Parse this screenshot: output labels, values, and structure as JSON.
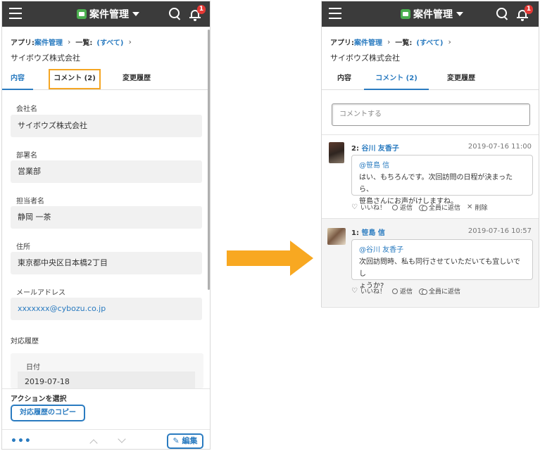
{
  "colors": {
    "accent": "#2a7bc0",
    "highlight": "#f5a623",
    "arrow": "#f8a821",
    "topbar": "#3b3b3b",
    "badge": "#e53935"
  },
  "left": {
    "app_title": "案件管理",
    "notification_count": "1",
    "breadcrumb": {
      "app_label": "アプリ:",
      "app_name": "案件管理",
      "list_label": "一覧:",
      "list_name": "(すべて)"
    },
    "record_title": "サイボウズ株式会社",
    "tabs": [
      "内容",
      "コメント (2)",
      "変更履歴"
    ],
    "fields": [
      {
        "label": "会社名",
        "value": "サイボウズ株式会社"
      },
      {
        "label": "部署名",
        "value": "営業部"
      },
      {
        "label": "担当者名",
        "value": "静岡 一茶"
      },
      {
        "label": "住所",
        "value": "東京都中央区日本橋2丁目"
      },
      {
        "label": "メールアドレス",
        "value": "xxxxxxx@cybozu.co.jp"
      }
    ],
    "history_section": "対応履歴",
    "history_date_label": "日付",
    "history_date_value": "2019-07-18",
    "action_label": "アクションを選択",
    "action_button": "対応履歴のコピー",
    "more": "•••",
    "edit_button": "✎ 編集"
  },
  "right": {
    "app_title": "案件管理",
    "notification_count": "1",
    "breadcrumb": {
      "app_label": "アプリ:",
      "app_name": "案件管理",
      "list_label": "一覧:",
      "list_name": "(すべて)"
    },
    "record_title": "サイボウズ株式会社",
    "tabs": [
      "内容",
      "コメント (2)",
      "変更履歴"
    ],
    "comment_placeholder": "コメントする",
    "comments": [
      {
        "number": "2:",
        "author": "谷川 友香子",
        "time": "2019-07-16 11:00",
        "mention": "@笹島 信",
        "body1": "はい、もちろんです。次回訪問の日程が決まったら、",
        "body2": "笹島さんにお声がけしますね。",
        "actions": [
          "いいね！",
          "返信",
          "全員に返信",
          "削除"
        ]
      },
      {
        "number": "1:",
        "author": "笹島 信",
        "time": "2019-07-16 10:57",
        "mention": "@谷川 友香子",
        "body1": "次回訪問時、私も同行させていただいても宜しいでし",
        "body2": "ょうか?",
        "actions": [
          "いいね！",
          "返信",
          "全員に返信"
        ]
      }
    ]
  }
}
